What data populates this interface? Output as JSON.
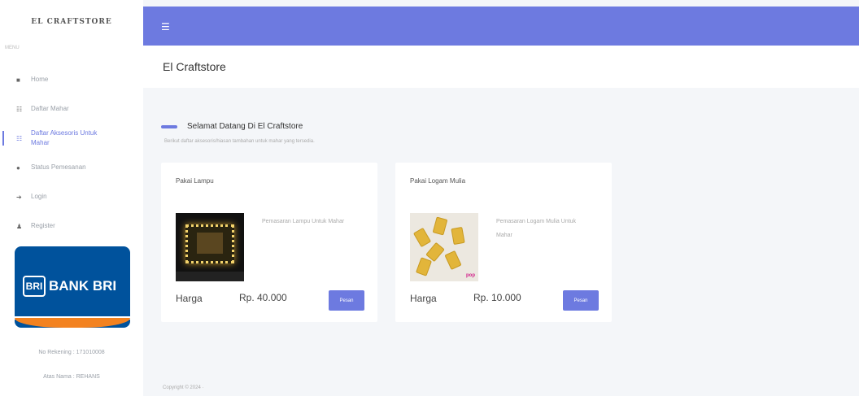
{
  "sidebar": {
    "brand": "EL CRAFTSTORE",
    "menu_label": "MENU",
    "items": [
      {
        "label": "Home",
        "icon": "home-icon",
        "glyph": "■"
      },
      {
        "label": "Daftar Mahar",
        "icon": "list-icon",
        "glyph": "☷"
      },
      {
        "label": "Daftar Aksesoris Untuk Mahar",
        "icon": "list-icon",
        "glyph": "☷"
      },
      {
        "label": "Status Pemesanan",
        "icon": "status-icon",
        "glyph": "●"
      },
      {
        "label": "Login",
        "icon": "login-icon",
        "glyph": "➔"
      },
      {
        "label": "Register",
        "icon": "user-icon",
        "glyph": "♟"
      }
    ],
    "bank": {
      "name": "BANK BRI",
      "mark": "BRI",
      "account_number": "No Rekening : 171010008",
      "account_name": "Atas Nama : REHANS"
    }
  },
  "topbar": {
    "menu_icon": "☰"
  },
  "header": {
    "title": "El Craftstore"
  },
  "welcome": {
    "title": "Selamat Datang Di El Craftstore",
    "subtitle": "Berikut daftar aksesoris/hiasan tambahan untuk mahar yang tersedia."
  },
  "cards": [
    {
      "title": "Pakai Lampu",
      "description": "Pemasaran Lampu Untuk Mahar",
      "price_label": "Harga",
      "price": "Rp. 40.000",
      "button": "Pesan"
    },
    {
      "title": "Pakai Logam Mulia",
      "description": "Pemasaran Logam Mulia Untuk Mahar",
      "price_label": "Harga",
      "price": "Rp. 10.000",
      "button": "Pesan",
      "image_tag": "pop"
    }
  ],
  "footer": {
    "text": "Copyright © 2024 ·"
  },
  "colors": {
    "accent": "#6d7ae0",
    "bri_blue": "#00529c",
    "bri_orange": "#f38220"
  }
}
